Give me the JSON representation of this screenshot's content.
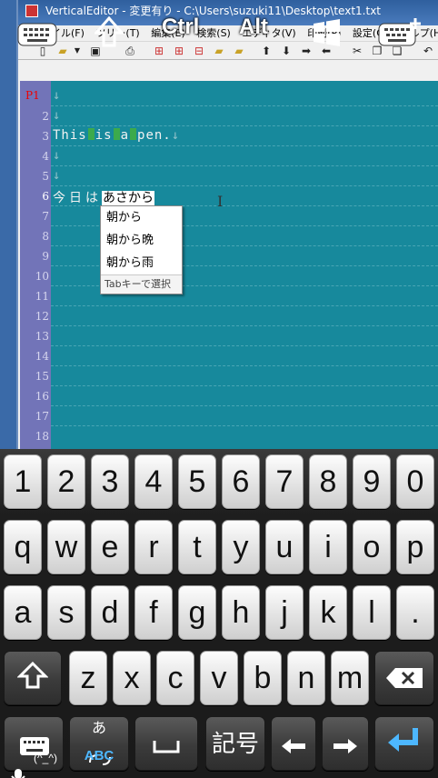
{
  "window": {
    "title": "VerticalEditor - 変更有り - C:\\Users\\suzuki11\\Desktop\\text1.txt"
  },
  "menu": [
    "ファイル(F)",
    "ツリー(T)",
    "編集(E)",
    "検索(S)",
    "エディタ(V)",
    "印刷(P)",
    "設定(O)",
    "ヘルプ(H)"
  ],
  "overlay": {
    "ctrl": "Ctrl",
    "alt": "Alt"
  },
  "editor": {
    "page_marker": "P1",
    "line_numbers": [
      "2",
      "3",
      "4",
      "5",
      "6",
      "7",
      "8",
      "9",
      "10",
      "11",
      "12",
      "13",
      "14",
      "15",
      "16",
      "17",
      "18"
    ],
    "line3_words": [
      "This",
      "is",
      "a",
      "pen."
    ],
    "newline_mark": "↓",
    "line6_prefix": "今日は",
    "line6_composition": "あさから"
  },
  "ime": {
    "candidates": [
      "朝から",
      "朝から晩",
      "朝から雨"
    ],
    "hint": "Tabキーで選択"
  },
  "keyboard": {
    "row1": [
      "1",
      "2",
      "3",
      "4",
      "5",
      "6",
      "7",
      "8",
      "9",
      "0"
    ],
    "row2": [
      "q",
      "w",
      "e",
      "r",
      "t",
      "y",
      "u",
      "i",
      "o",
      "p"
    ],
    "row3": [
      "a",
      "s",
      "d",
      "f",
      "g",
      "h",
      "j",
      "k",
      "l",
      "."
    ],
    "row4": [
      "z",
      "x",
      "c",
      "v",
      "b",
      "n",
      "m"
    ],
    "emoticon_label": "(^_^)",
    "mode_kana": "あ",
    "mode_abc": "ABC",
    "symbol_label": "記号"
  },
  "colors": {
    "editor_bg": "#17899c",
    "gutter_bg": "#7274b8",
    "space_marker": "#3caa4c",
    "page_marker": "#e00000"
  }
}
